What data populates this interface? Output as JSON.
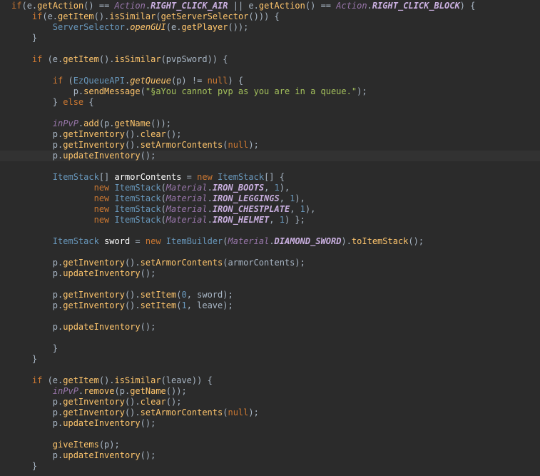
{
  "colors": {
    "background": "#2b2b2b",
    "current_line": "#323232",
    "keyword": "#cc7832",
    "plain": "#a9b7c6",
    "method": "#ffc66d",
    "class": "#6897bb",
    "enum_class": "#9876aa",
    "constant": "#c8aede",
    "string": "#a5c25c",
    "number": "#6897bb",
    "local_var": "#ffffff"
  },
  "lines": [
    {
      "indent": 0,
      "tokens": [
        [
          "kw",
          "if"
        ],
        [
          "p",
          "("
        ],
        [
          "p",
          "e."
        ],
        [
          "m",
          "getAction"
        ],
        [
          "p",
          "() == "
        ],
        [
          "ec",
          "Action"
        ],
        [
          "p",
          "."
        ],
        [
          "c",
          "RIGHT_CLICK_AIR"
        ],
        [
          "p",
          " || e."
        ],
        [
          "m",
          "getAction"
        ],
        [
          "p",
          "() == "
        ],
        [
          "ec",
          "Action"
        ],
        [
          "p",
          "."
        ],
        [
          "c",
          "RIGHT_CLICK_BLOCK"
        ],
        [
          "p",
          ") {"
        ]
      ]
    },
    {
      "indent": 4,
      "tokens": [
        [
          "kw",
          "if"
        ],
        [
          "p",
          "(e."
        ],
        [
          "m",
          "getItem"
        ],
        [
          "p",
          "()."
        ],
        [
          "m",
          "isSimilar"
        ],
        [
          "p",
          "("
        ],
        [
          "m",
          "getServerSelector"
        ],
        [
          "p",
          "())) {"
        ]
      ]
    },
    {
      "indent": 8,
      "tokens": [
        [
          "cl",
          "ServerSelector"
        ],
        [
          "p",
          "."
        ],
        [
          "s",
          "openGUI"
        ],
        [
          "p",
          "(e."
        ],
        [
          "m",
          "getPlayer"
        ],
        [
          "p",
          "());"
        ]
      ]
    },
    {
      "indent": 4,
      "tokens": [
        [
          "p",
          "}"
        ]
      ]
    },
    {
      "indent": 0,
      "tokens": []
    },
    {
      "indent": 4,
      "tokens": [
        [
          "kw",
          "if"
        ],
        [
          "p",
          " (e."
        ],
        [
          "m",
          "getItem"
        ],
        [
          "p",
          "()."
        ],
        [
          "m",
          "isSimilar"
        ],
        [
          "p",
          "(pvpSword)) {"
        ]
      ]
    },
    {
      "indent": 0,
      "tokens": []
    },
    {
      "indent": 8,
      "tokens": [
        [
          "kw",
          "if"
        ],
        [
          "p",
          " ("
        ],
        [
          "cl",
          "EzQueueAPI"
        ],
        [
          "p",
          "."
        ],
        [
          "s",
          "getQueue"
        ],
        [
          "p",
          "(p) != "
        ],
        [
          "kw",
          "null"
        ],
        [
          "p",
          ") {"
        ]
      ]
    },
    {
      "indent": 12,
      "tokens": [
        [
          "p",
          "p."
        ],
        [
          "m",
          "sendMessage"
        ],
        [
          "p",
          "("
        ],
        [
          "str",
          "\"§aYou cannot pvp as you are in a queue.\""
        ],
        [
          "p",
          ");"
        ]
      ]
    },
    {
      "indent": 8,
      "tokens": [
        [
          "p",
          "} "
        ],
        [
          "kw",
          "else"
        ],
        [
          "p",
          " {"
        ]
      ]
    },
    {
      "indent": 0,
      "tokens": []
    },
    {
      "indent": 8,
      "tokens": [
        [
          "f",
          "inPvP"
        ],
        [
          "p",
          "."
        ],
        [
          "m",
          "add"
        ],
        [
          "p",
          "(p."
        ],
        [
          "m",
          "getName"
        ],
        [
          "p",
          "());"
        ]
      ]
    },
    {
      "indent": 8,
      "tokens": [
        [
          "p",
          "p."
        ],
        [
          "m",
          "getInventory"
        ],
        [
          "p",
          "()."
        ],
        [
          "m",
          "clear"
        ],
        [
          "p",
          "();"
        ]
      ]
    },
    {
      "indent": 8,
      "tokens": [
        [
          "p",
          "p."
        ],
        [
          "m",
          "getInventory"
        ],
        [
          "p",
          "()."
        ],
        [
          "m",
          "setArmorContents"
        ],
        [
          "p",
          "("
        ],
        [
          "kw",
          "null"
        ],
        [
          "p",
          ");"
        ]
      ]
    },
    {
      "indent": 8,
      "current": true,
      "tokens": [
        [
          "p",
          "p."
        ],
        [
          "m",
          "updateInventory"
        ],
        [
          "p",
          "();"
        ]
      ]
    },
    {
      "indent": 0,
      "tokens": []
    },
    {
      "indent": 8,
      "tokens": [
        [
          "cl",
          "ItemStack"
        ],
        [
          "p",
          "[] "
        ],
        [
          "v",
          "armorContents"
        ],
        [
          "p",
          " = "
        ],
        [
          "kw",
          "new"
        ],
        [
          "p",
          " "
        ],
        [
          "cl",
          "ItemStack"
        ],
        [
          "p",
          "[] {"
        ]
      ]
    },
    {
      "indent": 16,
      "tokens": [
        [
          "kw",
          "new"
        ],
        [
          "p",
          " "
        ],
        [
          "cl",
          "ItemStack"
        ],
        [
          "p",
          "("
        ],
        [
          "ec",
          "Material"
        ],
        [
          "p",
          "."
        ],
        [
          "c",
          "IRON_BOOTS"
        ],
        [
          "p",
          ", "
        ],
        [
          "n",
          "1"
        ],
        [
          "p",
          "),"
        ]
      ]
    },
    {
      "indent": 16,
      "tokens": [
        [
          "kw",
          "new"
        ],
        [
          "p",
          " "
        ],
        [
          "cl",
          "ItemStack"
        ],
        [
          "p",
          "("
        ],
        [
          "ec",
          "Material"
        ],
        [
          "p",
          "."
        ],
        [
          "c",
          "IRON_LEGGINGS"
        ],
        [
          "p",
          ", "
        ],
        [
          "n",
          "1"
        ],
        [
          "p",
          "),"
        ]
      ]
    },
    {
      "indent": 16,
      "tokens": [
        [
          "kw",
          "new"
        ],
        [
          "p",
          " "
        ],
        [
          "cl",
          "ItemStack"
        ],
        [
          "p",
          "("
        ],
        [
          "ec",
          "Material"
        ],
        [
          "p",
          "."
        ],
        [
          "c",
          "IRON_CHESTPLATE"
        ],
        [
          "p",
          ", "
        ],
        [
          "n",
          "1"
        ],
        [
          "p",
          "),"
        ]
      ]
    },
    {
      "indent": 16,
      "tokens": [
        [
          "kw",
          "new"
        ],
        [
          "p",
          " "
        ],
        [
          "cl",
          "ItemStack"
        ],
        [
          "p",
          "("
        ],
        [
          "ec",
          "Material"
        ],
        [
          "p",
          "."
        ],
        [
          "c",
          "IRON_HELMET"
        ],
        [
          "p",
          ", "
        ],
        [
          "n",
          "1"
        ],
        [
          "p",
          ") };"
        ]
      ]
    },
    {
      "indent": 0,
      "tokens": []
    },
    {
      "indent": 8,
      "tokens": [
        [
          "cl",
          "ItemStack"
        ],
        [
          "p",
          " "
        ],
        [
          "v",
          "sword"
        ],
        [
          "p",
          " = "
        ],
        [
          "kw",
          "new"
        ],
        [
          "p",
          " "
        ],
        [
          "cl",
          "ItemBuilder"
        ],
        [
          "p",
          "("
        ],
        [
          "ec",
          "Material"
        ],
        [
          "p",
          "."
        ],
        [
          "c",
          "DIAMOND_SWORD"
        ],
        [
          "p",
          ")."
        ],
        [
          "m",
          "toItemStack"
        ],
        [
          "p",
          "();"
        ]
      ]
    },
    {
      "indent": 0,
      "tokens": []
    },
    {
      "indent": 8,
      "tokens": [
        [
          "p",
          "p."
        ],
        [
          "m",
          "getInventory"
        ],
        [
          "p",
          "()."
        ],
        [
          "m",
          "setArmorContents"
        ],
        [
          "p",
          "(armorContents);"
        ]
      ]
    },
    {
      "indent": 8,
      "tokens": [
        [
          "p",
          "p."
        ],
        [
          "m",
          "updateInventory"
        ],
        [
          "p",
          "();"
        ]
      ]
    },
    {
      "indent": 0,
      "tokens": []
    },
    {
      "indent": 8,
      "tokens": [
        [
          "p",
          "p."
        ],
        [
          "m",
          "getInventory"
        ],
        [
          "p",
          "()."
        ],
        [
          "m",
          "setItem"
        ],
        [
          "p",
          "("
        ],
        [
          "n",
          "0"
        ],
        [
          "p",
          ", sword);"
        ]
      ]
    },
    {
      "indent": 8,
      "tokens": [
        [
          "p",
          "p."
        ],
        [
          "m",
          "getInventory"
        ],
        [
          "p",
          "()."
        ],
        [
          "m",
          "setItem"
        ],
        [
          "p",
          "("
        ],
        [
          "n",
          "1"
        ],
        [
          "p",
          ", leave);"
        ]
      ]
    },
    {
      "indent": 0,
      "tokens": []
    },
    {
      "indent": 8,
      "tokens": [
        [
          "p",
          "p."
        ],
        [
          "m",
          "updateInventory"
        ],
        [
          "p",
          "();"
        ]
      ]
    },
    {
      "indent": 0,
      "tokens": []
    },
    {
      "indent": 8,
      "tokens": [
        [
          "p",
          "}"
        ]
      ]
    },
    {
      "indent": 4,
      "tokens": [
        [
          "p",
          "}"
        ]
      ]
    },
    {
      "indent": 0,
      "tokens": []
    },
    {
      "indent": 4,
      "tokens": [
        [
          "kw",
          "if"
        ],
        [
          "p",
          " (e."
        ],
        [
          "m",
          "getItem"
        ],
        [
          "p",
          "()."
        ],
        [
          "m",
          "isSimilar"
        ],
        [
          "p",
          "(leave)) {"
        ]
      ]
    },
    {
      "indent": 8,
      "tokens": [
        [
          "f",
          "inPvP"
        ],
        [
          "p",
          "."
        ],
        [
          "m",
          "remove"
        ],
        [
          "p",
          "(p."
        ],
        [
          "m",
          "getName"
        ],
        [
          "p",
          "());"
        ]
      ]
    },
    {
      "indent": 8,
      "tokens": [
        [
          "p",
          "p."
        ],
        [
          "m",
          "getInventory"
        ],
        [
          "p",
          "()."
        ],
        [
          "m",
          "clear"
        ],
        [
          "p",
          "();"
        ]
      ]
    },
    {
      "indent": 8,
      "tokens": [
        [
          "p",
          "p."
        ],
        [
          "m",
          "getInventory"
        ],
        [
          "p",
          "()."
        ],
        [
          "m",
          "setArmorContents"
        ],
        [
          "p",
          "("
        ],
        [
          "kw",
          "null"
        ],
        [
          "p",
          ");"
        ]
      ]
    },
    {
      "indent": 8,
      "tokens": [
        [
          "p",
          "p."
        ],
        [
          "m",
          "updateInventory"
        ],
        [
          "p",
          "();"
        ]
      ]
    },
    {
      "indent": 0,
      "tokens": []
    },
    {
      "indent": 8,
      "tokens": [
        [
          "m",
          "giveItems"
        ],
        [
          "p",
          "(p);"
        ]
      ]
    },
    {
      "indent": 8,
      "tokens": [
        [
          "p",
          "p."
        ],
        [
          "m",
          "updateInventory"
        ],
        [
          "p",
          "();"
        ]
      ]
    },
    {
      "indent": 4,
      "tokens": [
        [
          "p",
          "}"
        ]
      ]
    }
  ]
}
